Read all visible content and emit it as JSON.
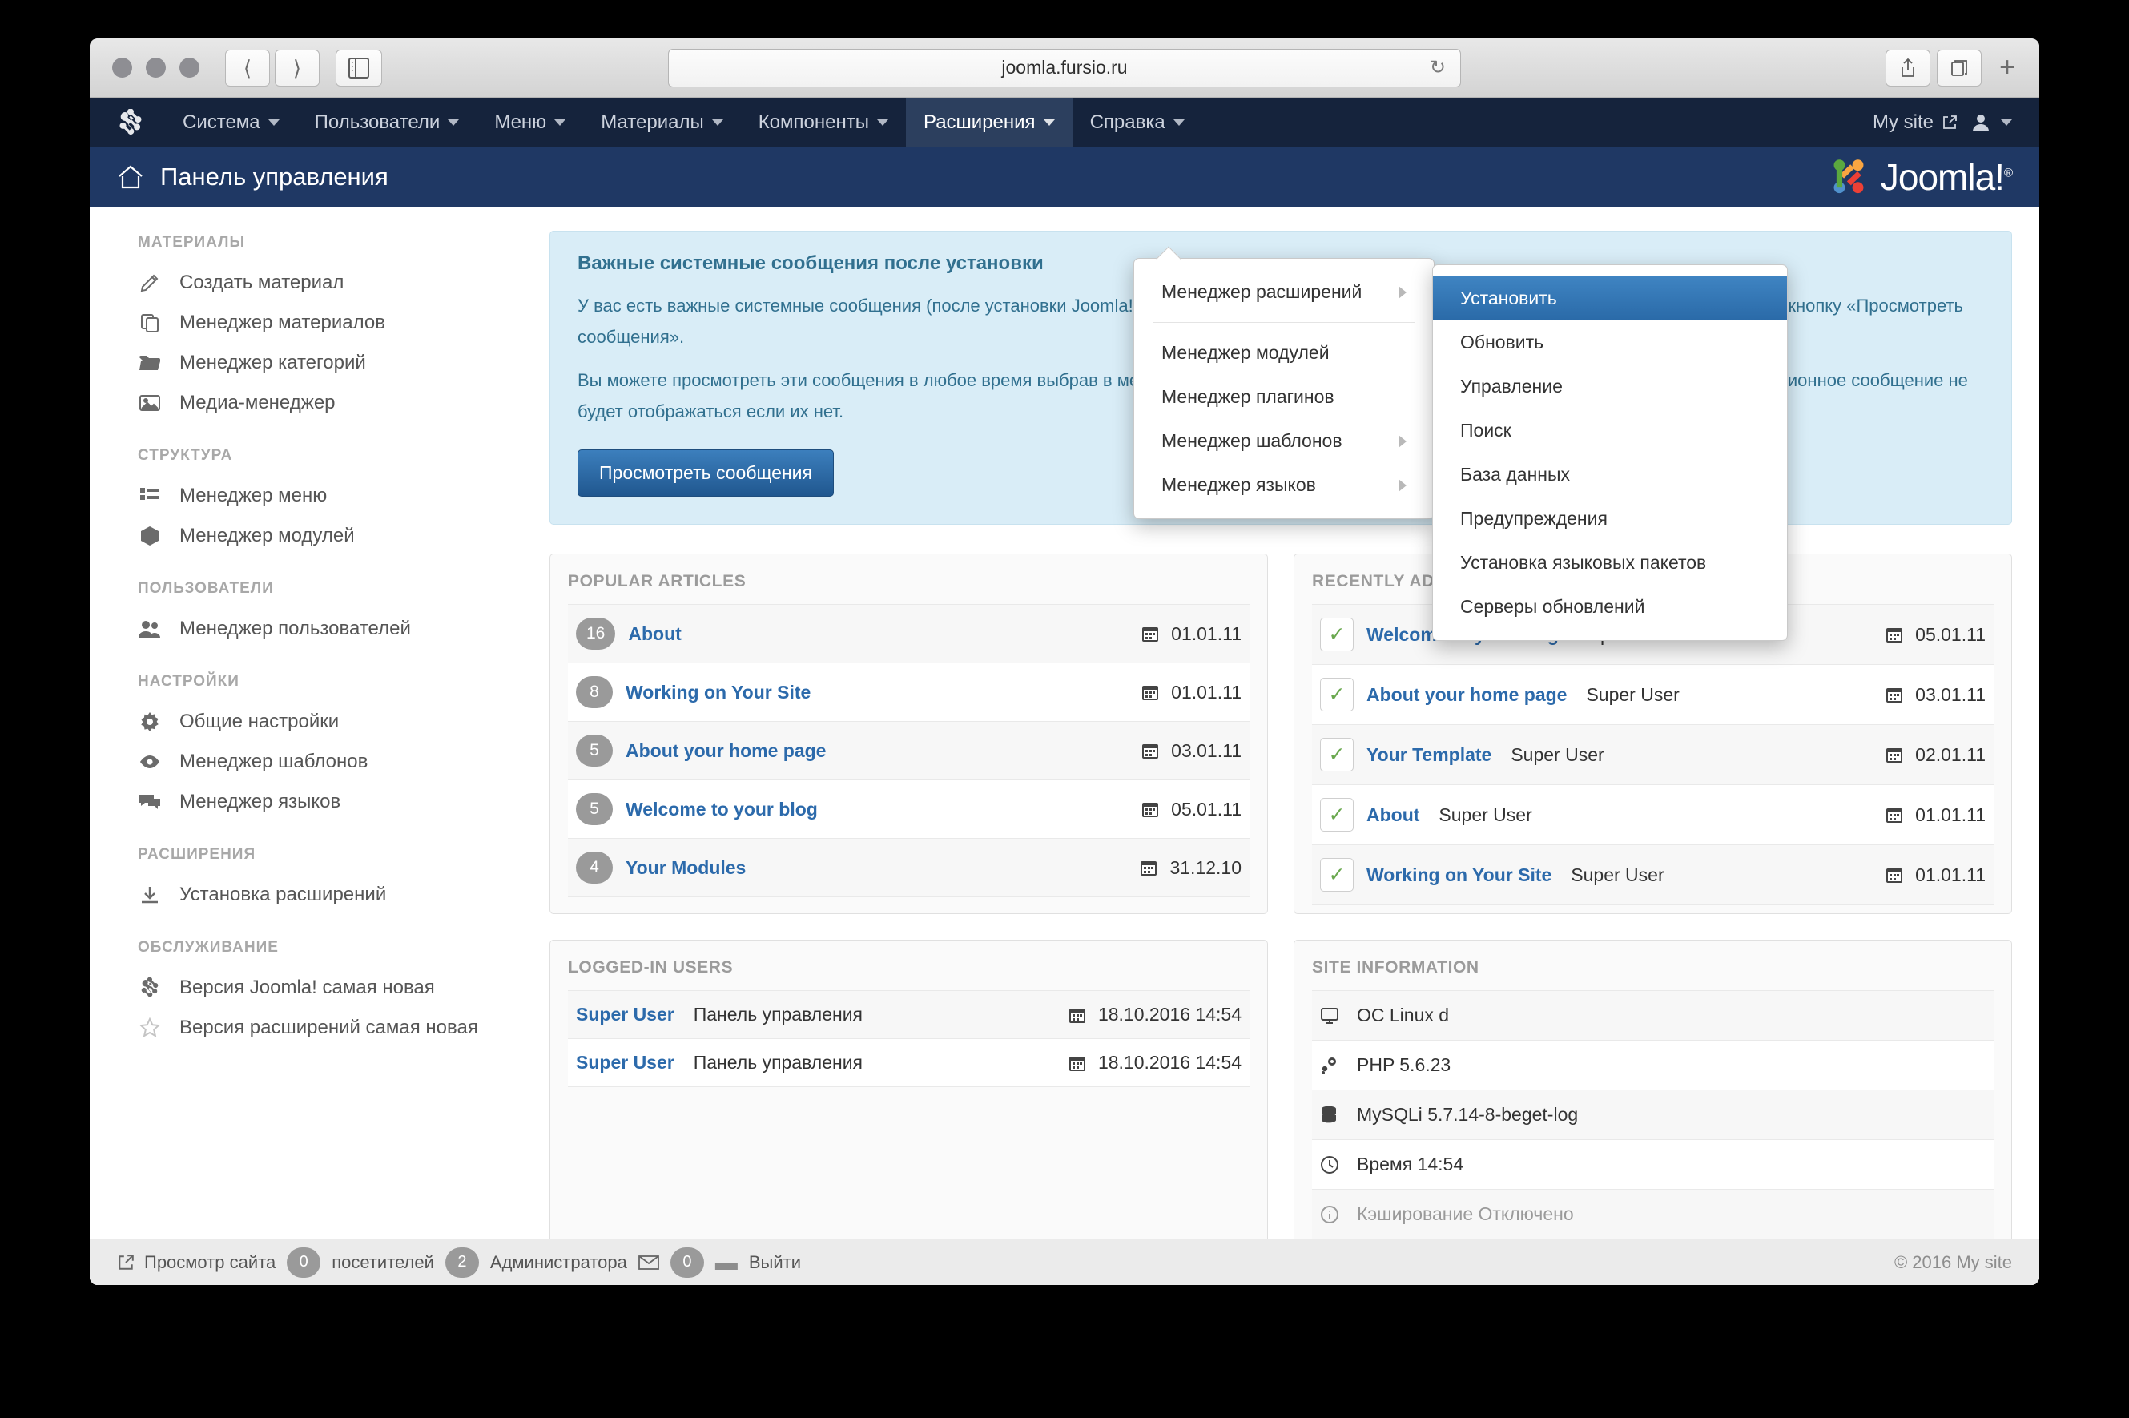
{
  "browser": {
    "url": "joomla.fursio.ru",
    "back_icon": "back-chevron-icon",
    "forward_icon": "forward-chevron-icon",
    "sidebar_icon": "sidebar-toggle-icon",
    "reload_icon": "reload-icon",
    "share_icon": "share-icon",
    "tabs_icon": "tabs-overview-icon",
    "newtab_label": "+"
  },
  "topnav": {
    "logo": "joomla-mark-icon",
    "items": [
      {
        "label": "Система",
        "has_caret": true,
        "open": false
      },
      {
        "label": "Пользователи",
        "has_caret": true,
        "open": false
      },
      {
        "label": "Меню",
        "has_caret": true,
        "open": false
      },
      {
        "label": "Материалы",
        "has_caret": true,
        "open": false
      },
      {
        "label": "Компоненты",
        "has_caret": true,
        "open": false
      },
      {
        "label": "Расширения",
        "has_caret": true,
        "open": true
      },
      {
        "label": "Справка",
        "has_caret": true,
        "open": false
      }
    ],
    "my_site": "My site",
    "my_site_icon": "external-link-icon",
    "user_icon": "user-icon",
    "user_caret_icon": "chevron-down-icon"
  },
  "dropdown_extensions": {
    "items": [
      {
        "label": "Менеджер расширений",
        "submenu": true
      },
      {
        "separator": true
      },
      {
        "label": "Менеджер модулей",
        "submenu": false
      },
      {
        "label": "Менеджер плагинов",
        "submenu": false
      },
      {
        "label": "Менеджер шаблонов",
        "submenu": true
      },
      {
        "label": "Менеджер языков",
        "submenu": true
      }
    ]
  },
  "dropdown_extension_manager": {
    "items": [
      {
        "label": "Установить",
        "active": true
      },
      {
        "label": "Обновить",
        "active": false
      },
      {
        "label": "Управление",
        "active": false
      },
      {
        "label": "Поиск",
        "active": false
      },
      {
        "label": "База данных",
        "active": false
      },
      {
        "label": "Предупреждения",
        "active": false
      },
      {
        "label": "Установка языковых пакетов",
        "active": false
      },
      {
        "label": "Серверы обновлений",
        "active": false
      }
    ]
  },
  "subheader": {
    "home_icon": "home-icon",
    "title": "Панель управления",
    "brand_text": "Joomla!",
    "brand_reg": "®",
    "brand_mark_icon": "joomla-logo-icon"
  },
  "sidebar": {
    "sections": [
      {
        "title": "МАТЕРИАЛЫ",
        "items": [
          {
            "label": "Создать материал",
            "icon": "pencil-icon"
          },
          {
            "label": "Менеджер материалов",
            "icon": "copy-icon"
          },
          {
            "label": "Менеджер категорий",
            "icon": "folder-icon"
          },
          {
            "label": "Медиа-менеджер",
            "icon": "image-icon"
          }
        ]
      },
      {
        "title": "СТРУКТУРА",
        "items": [
          {
            "label": "Менеджер меню",
            "icon": "list-icon"
          },
          {
            "label": "Менеджер модулей",
            "icon": "cube-icon"
          }
        ]
      },
      {
        "title": "ПОЛЬЗОВАТЕЛИ",
        "items": [
          {
            "label": "Менеджер пользователей",
            "icon": "users-icon"
          }
        ]
      },
      {
        "title": "НАСТРОЙКИ",
        "items": [
          {
            "label": "Общие настройки",
            "icon": "gear-icon"
          },
          {
            "label": "Менеджер шаблонов",
            "icon": "eye-icon"
          },
          {
            "label": "Менеджер языков",
            "icon": "comments-icon"
          }
        ]
      },
      {
        "title": "РАСШИРЕНИЯ",
        "items": [
          {
            "label": "Установка расширений",
            "icon": "download-icon"
          }
        ]
      },
      {
        "title": "ОБСЛУЖИВАНИЕ",
        "items": [
          {
            "label": "Версия Joomla! самая новая",
            "icon": "joomla-mark-icon"
          },
          {
            "label": "Версия расширений самая новая",
            "icon": "star-icon"
          }
        ]
      }
    ]
  },
  "alert": {
    "title": "Важные системные сообщения после установки",
    "paragraph1": "У вас есть важные системные сообщения (после установки Joomla!), которые требуют вашего внимания. Для просмотра этих сообщений нажмите кнопку «Просмотреть сообщения».",
    "paragraph2": "Вы можете просмотреть эти сообщения в любое время выбрав в меню панели управления пункт Система - Системные сообщения. Это информационное сообщение не будет отображаться если их нет.",
    "button": "Просмотреть сообщения"
  },
  "popular_articles": {
    "title": "POPULAR ARTICLES",
    "rows": [
      {
        "count": "16",
        "title": "About",
        "date": "01.01.11"
      },
      {
        "count": "8",
        "title": "Working on Your Site",
        "date": "01.01.11"
      },
      {
        "count": "5",
        "title": "About your home page",
        "date": "03.01.11"
      },
      {
        "count": "5",
        "title": "Welcome to your blog",
        "date": "05.01.11"
      },
      {
        "count": "4",
        "title": "Your Modules",
        "date": "31.12.10"
      }
    ]
  },
  "recently_added": {
    "title": "RECENTLY ADDED ARTICLES",
    "rows": [
      {
        "title": "Welcome to your blog",
        "author": "Super User",
        "date": "05.01.11"
      },
      {
        "title": "About your home page",
        "author": "Super User",
        "date": "03.01.11"
      },
      {
        "title": "Your Template",
        "author": "Super User",
        "date": "02.01.11"
      },
      {
        "title": "About",
        "author": "Super User",
        "date": "01.01.11"
      },
      {
        "title": "Working on Your Site",
        "author": "Super User",
        "date": "01.01.11"
      }
    ]
  },
  "logged_in_users": {
    "title": "LOGGED-IN USERS",
    "rows": [
      {
        "user": "Super User",
        "location": "Панель управления",
        "date": "18.10.2016 14:54"
      },
      {
        "user": "Super User",
        "location": "Панель управления",
        "date": "18.10.2016 14:54"
      }
    ]
  },
  "site_information": {
    "title": "SITE INFORMATION",
    "rows": [
      {
        "icon": "monitor-icon",
        "text": "ОС Linux d",
        "muted": false
      },
      {
        "icon": "php-gear-icon",
        "text": "PHP 5.6.23",
        "muted": false
      },
      {
        "icon": "database-icon",
        "text": "MySQLi 5.7.14-8-beget-log",
        "muted": false
      },
      {
        "icon": "clock-icon",
        "text": "Время 14:54",
        "muted": false
      },
      {
        "icon": "info-icon",
        "text": "Кэширование Отключено",
        "muted": true
      }
    ]
  },
  "statusbar": {
    "view_site_icon": "external-link-icon",
    "view_site": "Просмотр сайта",
    "visitors_count": "0",
    "visitors_label": "посетителей",
    "admins_count": "2",
    "admins_label": "Администратора",
    "mail_icon": "envelope-icon",
    "mail_count": "0",
    "logout_icon": "minus-icon",
    "logout": "Выйти",
    "copyright": "© 2016 My site"
  },
  "colors": {
    "topnav_bg": "#15233c",
    "subhead_bg": "#1f3864",
    "accent_link": "#2c6aab",
    "alert_bg": "#d9edf7",
    "alert_text": "#31708f",
    "active_item": "#2a6aa8"
  }
}
